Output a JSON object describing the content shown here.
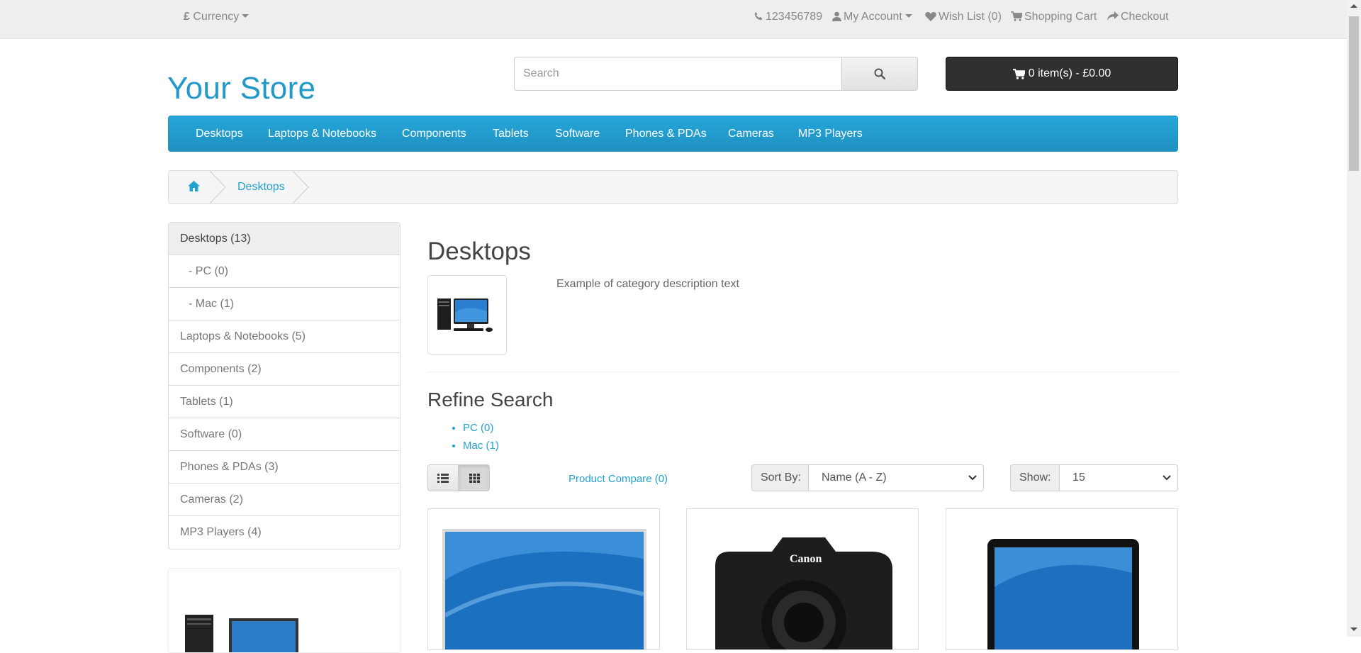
{
  "topbar": {
    "currency_symbol": "£",
    "currency_label": "Currency",
    "phone": "123456789",
    "account": "My Account",
    "wishlist": "Wish List (0)",
    "cart": "Shopping Cart",
    "checkout": "Checkout"
  },
  "header": {
    "logo": "Your Store",
    "search_placeholder": "Search",
    "cart_button": "0 item(s) - £0.00"
  },
  "menu": [
    "Desktops",
    "Laptops & Notebooks",
    "Components",
    "Tablets",
    "Software",
    "Phones & PDAs",
    "Cameras",
    "MP3 Players"
  ],
  "breadcrumb": {
    "current": "Desktops"
  },
  "sidebar": {
    "categories": [
      {
        "label": "Desktops (13)",
        "active": true,
        "sub": false
      },
      {
        "label": "- PC (0)",
        "active": false,
        "sub": true
      },
      {
        "label": "- Mac (1)",
        "active": false,
        "sub": true
      },
      {
        "label": "Laptops & Notebooks (5)",
        "active": false,
        "sub": false
      },
      {
        "label": "Components (2)",
        "active": false,
        "sub": false
      },
      {
        "label": "Tablets (1)",
        "active": false,
        "sub": false
      },
      {
        "label": "Software (0)",
        "active": false,
        "sub": false
      },
      {
        "label": "Phones & PDAs (3)",
        "active": false,
        "sub": false
      },
      {
        "label": "Cameras (2)",
        "active": false,
        "sub": false
      },
      {
        "label": "MP3 Players (4)",
        "active": false,
        "sub": false
      }
    ]
  },
  "main": {
    "title": "Desktops",
    "description": "Example of category description text",
    "refine_title": "Refine Search",
    "refine": [
      "PC (0)",
      "Mac (1)"
    ],
    "compare": "Product Compare (0)",
    "sort_label": "Sort By:",
    "sort_value": "Name (A - Z)",
    "show_label": "Show:",
    "show_value": "15"
  },
  "colors": {
    "brand": "#229ac8",
    "menu_bg": "#229ac8",
    "cart_button_bg": "#303030",
    "link": "#23a1d1"
  },
  "icons": [
    "phone-icon",
    "user-icon",
    "heart-icon",
    "cart-icon",
    "share-icon",
    "search-icon",
    "home-icon",
    "list-view-icon",
    "grid-view-icon"
  ]
}
